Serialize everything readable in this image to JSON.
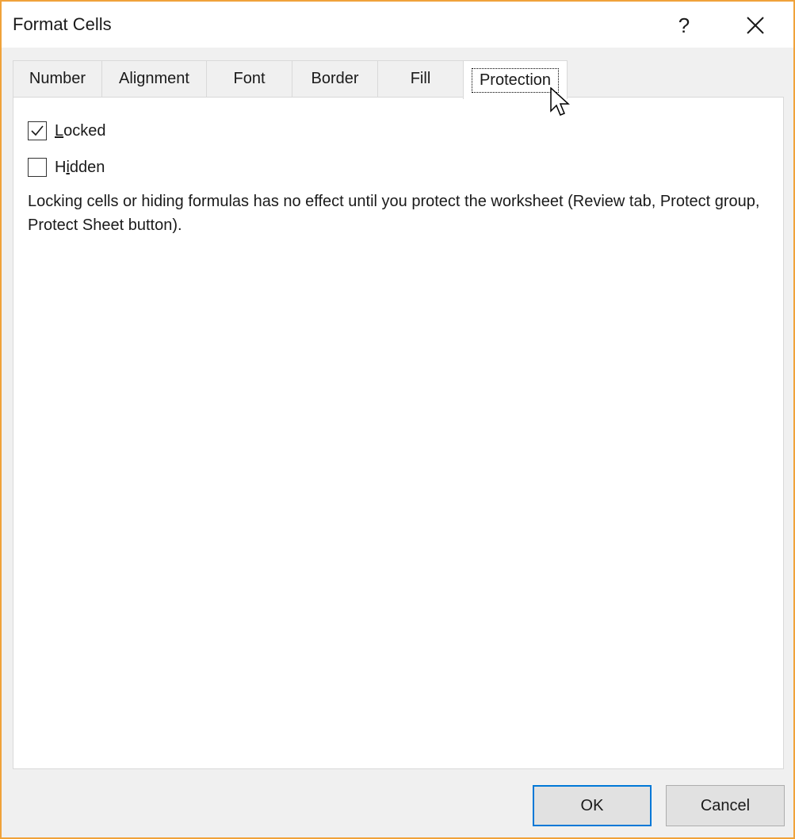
{
  "window": {
    "title": "Format Cells",
    "accent_border_color": "#f0a23a",
    "help_label": "?",
    "close_icon": "close-icon"
  },
  "tabs": [
    {
      "label": "Number",
      "selected": false
    },
    {
      "label": "Alignment",
      "selected": false
    },
    {
      "label": "Font",
      "selected": false
    },
    {
      "label": "Border",
      "selected": false
    },
    {
      "label": "Fill",
      "selected": false
    },
    {
      "label": "Protection",
      "selected": true
    }
  ],
  "protection": {
    "locked": {
      "label_access": "L",
      "label_rest": "ocked",
      "checked": true
    },
    "hidden": {
      "label_pre": "H",
      "label_access": "i",
      "label_rest": "dden",
      "checked": false
    },
    "note": "Locking cells or hiding formulas has no effect until you protect the worksheet (Review tab, Protect group, Protect Sheet button)."
  },
  "buttons": {
    "ok_label": "OK",
    "cancel_label": "Cancel",
    "default_color": "#0078d7"
  },
  "cursor": {
    "icon": "mouse-pointer-icon"
  }
}
